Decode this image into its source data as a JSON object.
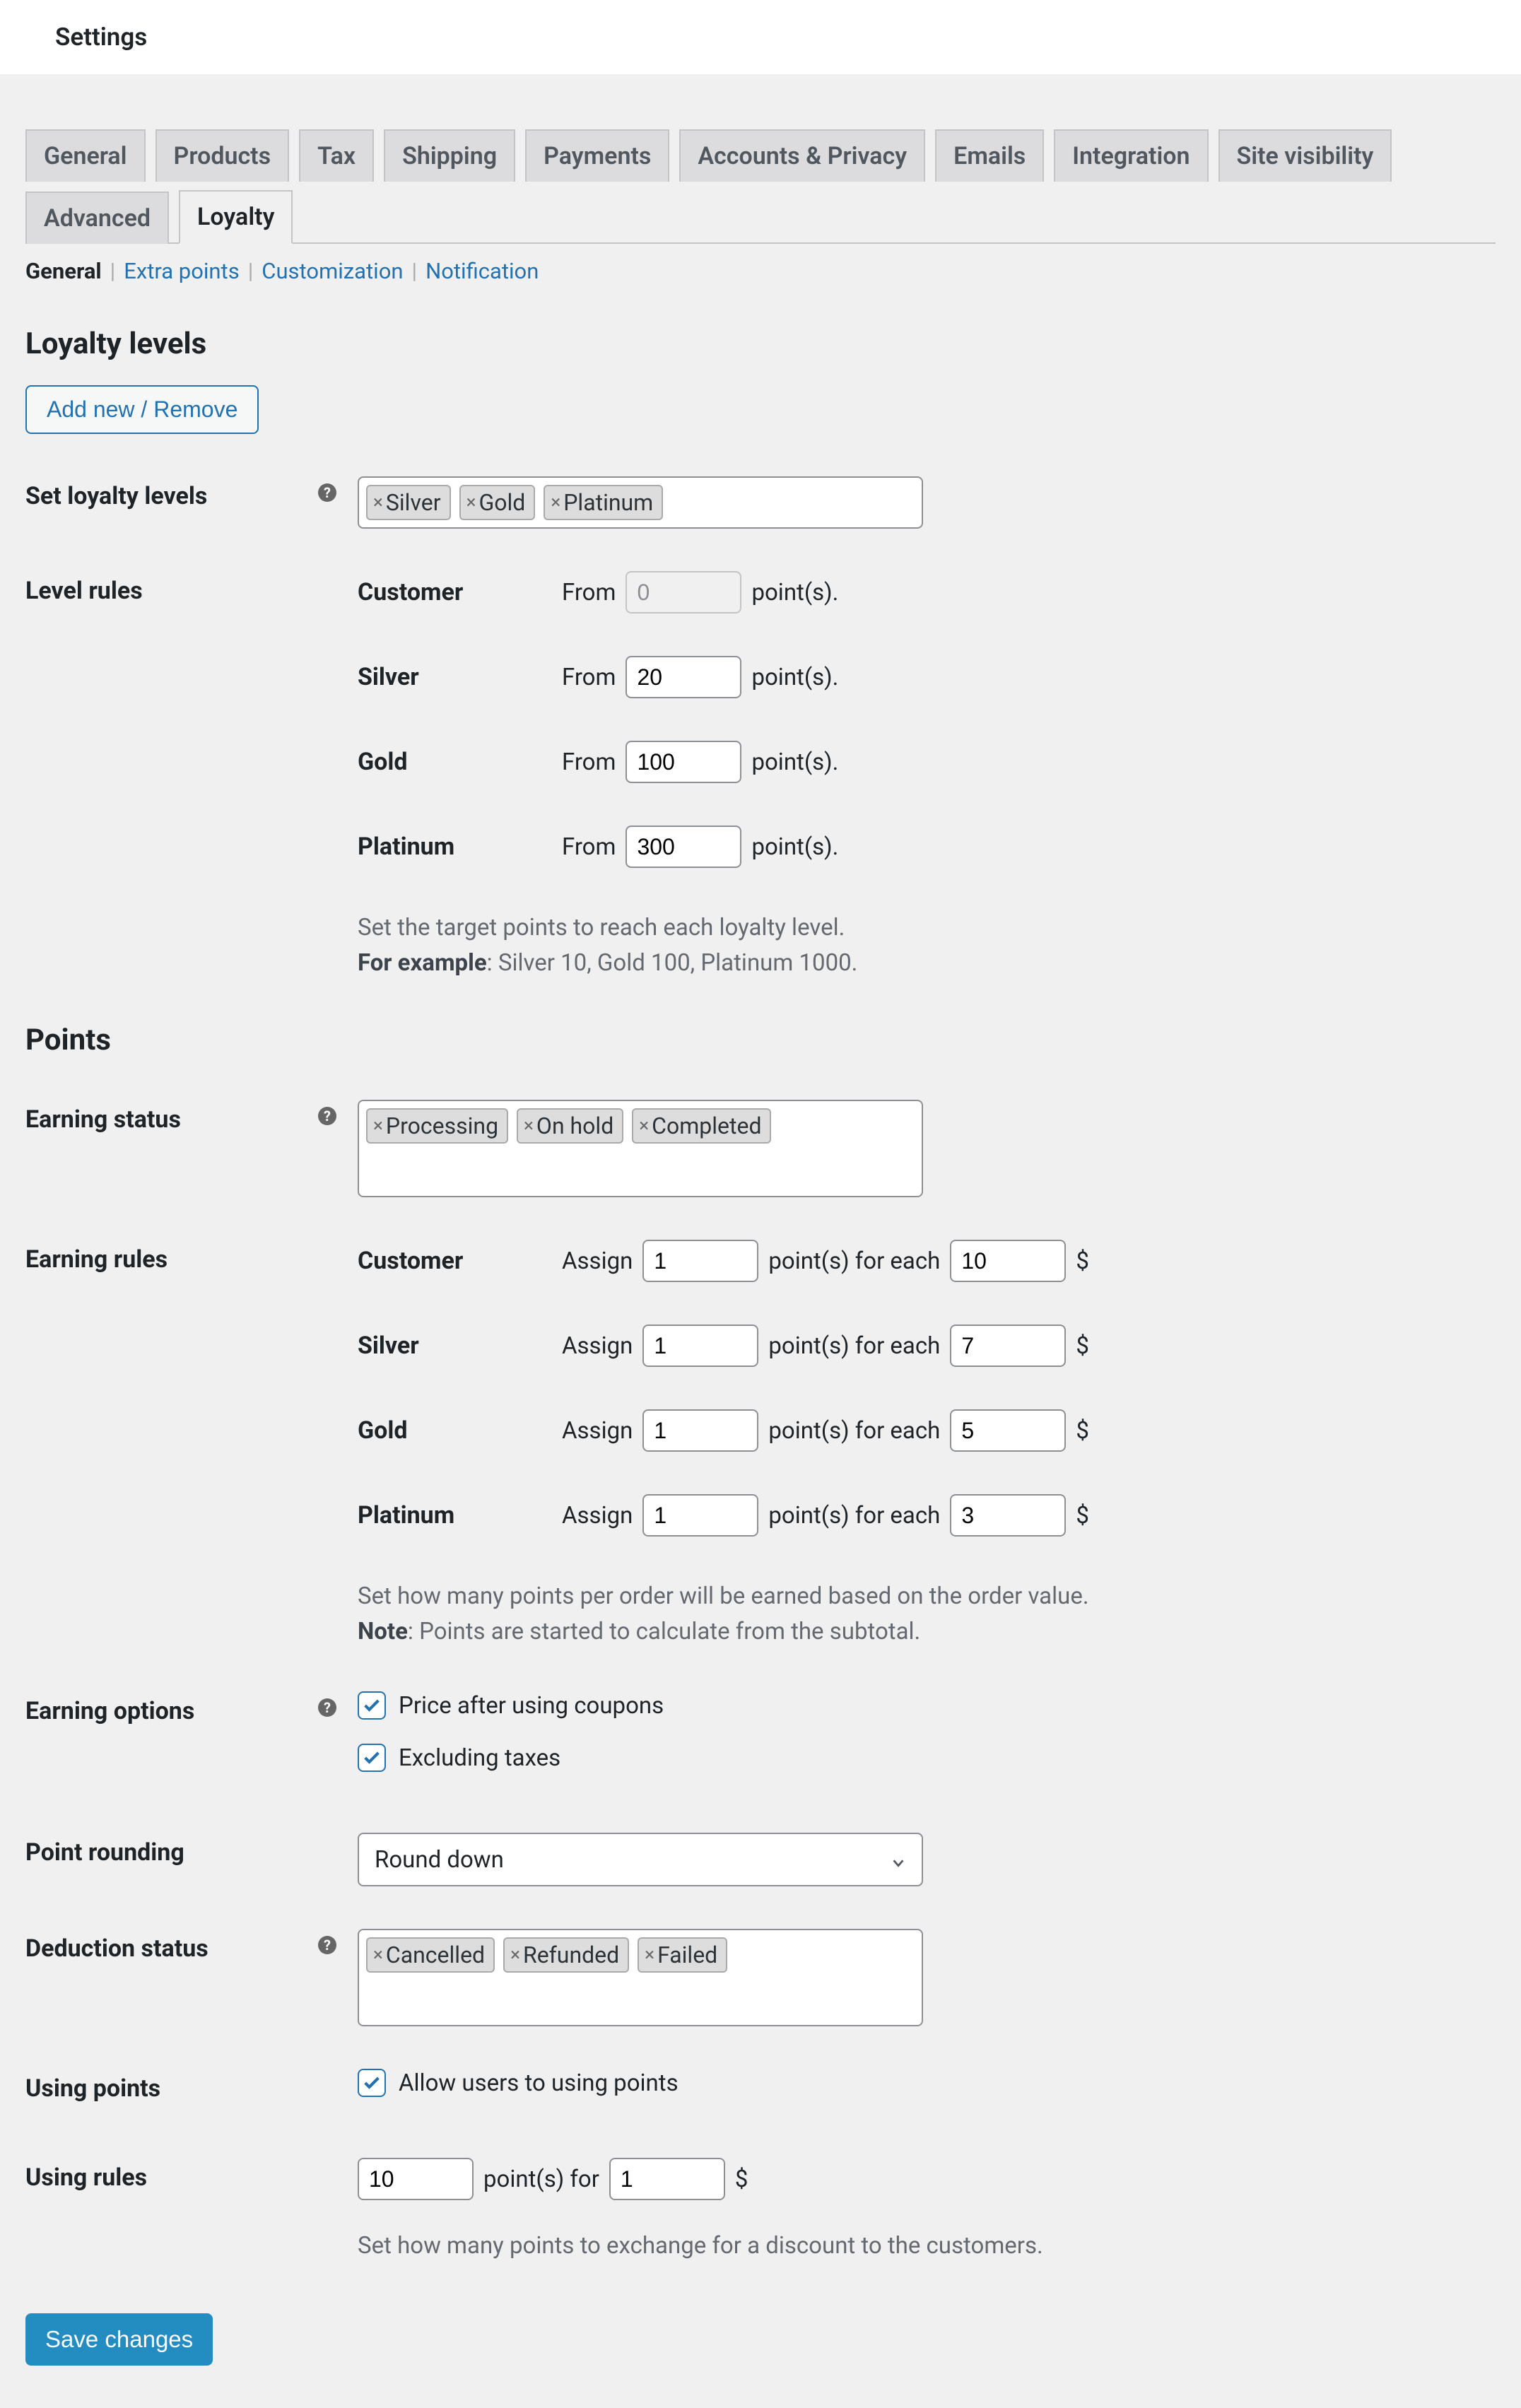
{
  "page_title": "Settings",
  "tabs": [
    "General",
    "Products",
    "Tax",
    "Shipping",
    "Payments",
    "Accounts & Privacy",
    "Emails",
    "Integration",
    "Site visibility",
    "Advanced",
    "Loyalty"
  ],
  "active_tab": "Loyalty",
  "subtabs": {
    "current": "General",
    "links": [
      "Extra points",
      "Customization",
      "Notification"
    ]
  },
  "loyalty": {
    "heading": "Loyalty levels",
    "add_remove": "Add new / Remove",
    "set_label": "Set loyalty levels",
    "tags": [
      "Silver",
      "Gold",
      "Platinum"
    ],
    "rules_label": "Level rules",
    "from_text": "From",
    "points_text": "point(s).",
    "rows": [
      {
        "name": "Customer",
        "value": "0",
        "disabled": true
      },
      {
        "name": "Silver",
        "value": "20",
        "disabled": false
      },
      {
        "name": "Gold",
        "value": "100",
        "disabled": false
      },
      {
        "name": "Platinum",
        "value": "300",
        "disabled": false
      }
    ],
    "help1": "Set the target points to reach each loyalty level.",
    "help2_bold": "For example",
    "help2_rest": ": Silver 10, Gold 100, Platinum 1000."
  },
  "points": {
    "heading": "Points",
    "earn_status_label": "Earning status",
    "earn_status_tags": [
      "Processing",
      "On hold",
      "Completed"
    ],
    "earn_rules_label": "Earning rules",
    "assign_text": "Assign",
    "pts_each": "point(s) for each",
    "currency": "$",
    "earn_rows": [
      {
        "name": "Customer",
        "pts": "1",
        "per": "10"
      },
      {
        "name": "Silver",
        "pts": "1",
        "per": "7"
      },
      {
        "name": "Gold",
        "pts": "1",
        "per": "5"
      },
      {
        "name": "Platinum",
        "pts": "1",
        "per": "3"
      }
    ],
    "earn_help1": "Set how many points per order will be earned based on the order value.",
    "earn_help2_bold": "Note",
    "earn_help2_rest": ": Points are started to calculate from the subtotal.",
    "earn_options_label": "Earning options",
    "opt_coupons": "Price after using coupons",
    "opt_taxes": "Excluding taxes",
    "rounding_label": "Point rounding",
    "rounding_value": "Round down",
    "deduct_label": "Deduction status",
    "deduct_tags": [
      "Cancelled",
      "Refunded",
      "Failed"
    ],
    "using_label": "Using points",
    "using_cb": "Allow users to using points",
    "using_rules_label": "Using rules",
    "using_pts": "10",
    "using_for": "point(s) for",
    "using_amount": "1",
    "using_currency": "$",
    "using_help": "Set how many points to exchange for a discount to the customers."
  },
  "save": "Save changes"
}
